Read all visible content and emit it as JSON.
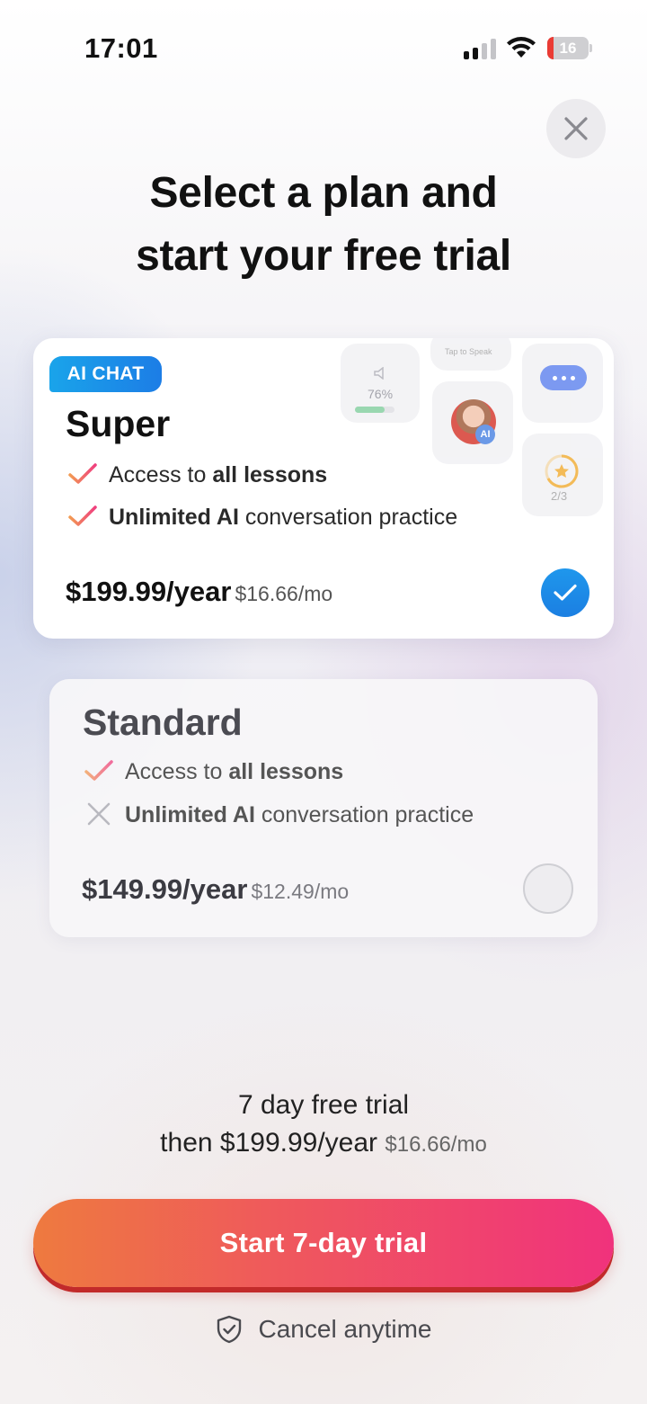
{
  "status_bar": {
    "time": "17:01",
    "battery": "16",
    "battery_level": 0.16
  },
  "header": {
    "title_line1": "Select a plan and",
    "title_line2": "start your free trial"
  },
  "plans": [
    {
      "badge": "AI CHAT",
      "name": "Super",
      "features": [
        {
          "prefix": "Access to ",
          "bold": "all lessons",
          "suffix": "",
          "included": true
        },
        {
          "prefix": "",
          "bold": "Unlimited AI",
          "suffix": " conversation practice",
          "included": true
        }
      ],
      "price": "$199.99/year",
      "monthly": "$16.66/mo",
      "selected": true,
      "preview": {
        "progress_label": "76%",
        "progress": 0.76,
        "speak_label": "Tap to Speak",
        "avatar_badge": "AI",
        "step_label": "2/3"
      }
    },
    {
      "name": "Standard",
      "features": [
        {
          "prefix": "Access to ",
          "bold": "all lessons",
          "suffix": "",
          "included": true
        },
        {
          "prefix": "",
          "bold": "Unlimited AI",
          "suffix": " conversation practice",
          "included": false
        }
      ],
      "price": "$149.99/year",
      "monthly": "$12.49/mo",
      "selected": false
    }
  ],
  "trial": {
    "line1": "7 day free trial",
    "line2_main": "then $199.99/year",
    "line2_sub": "$16.66/mo"
  },
  "cta": {
    "label": "Start 7-day trial"
  },
  "cancel": {
    "label": "Cancel anytime"
  },
  "colors": {
    "accent_blue": "#1c8be8",
    "cta_start": "#ee7a3f",
    "cta_end": "#f0327c",
    "check_pink": "#ef4b7a"
  },
  "icons": [
    "signal-icon",
    "wifi-icon",
    "battery-icon",
    "close-icon",
    "check-icon",
    "cross-icon",
    "shield-check-icon"
  ]
}
